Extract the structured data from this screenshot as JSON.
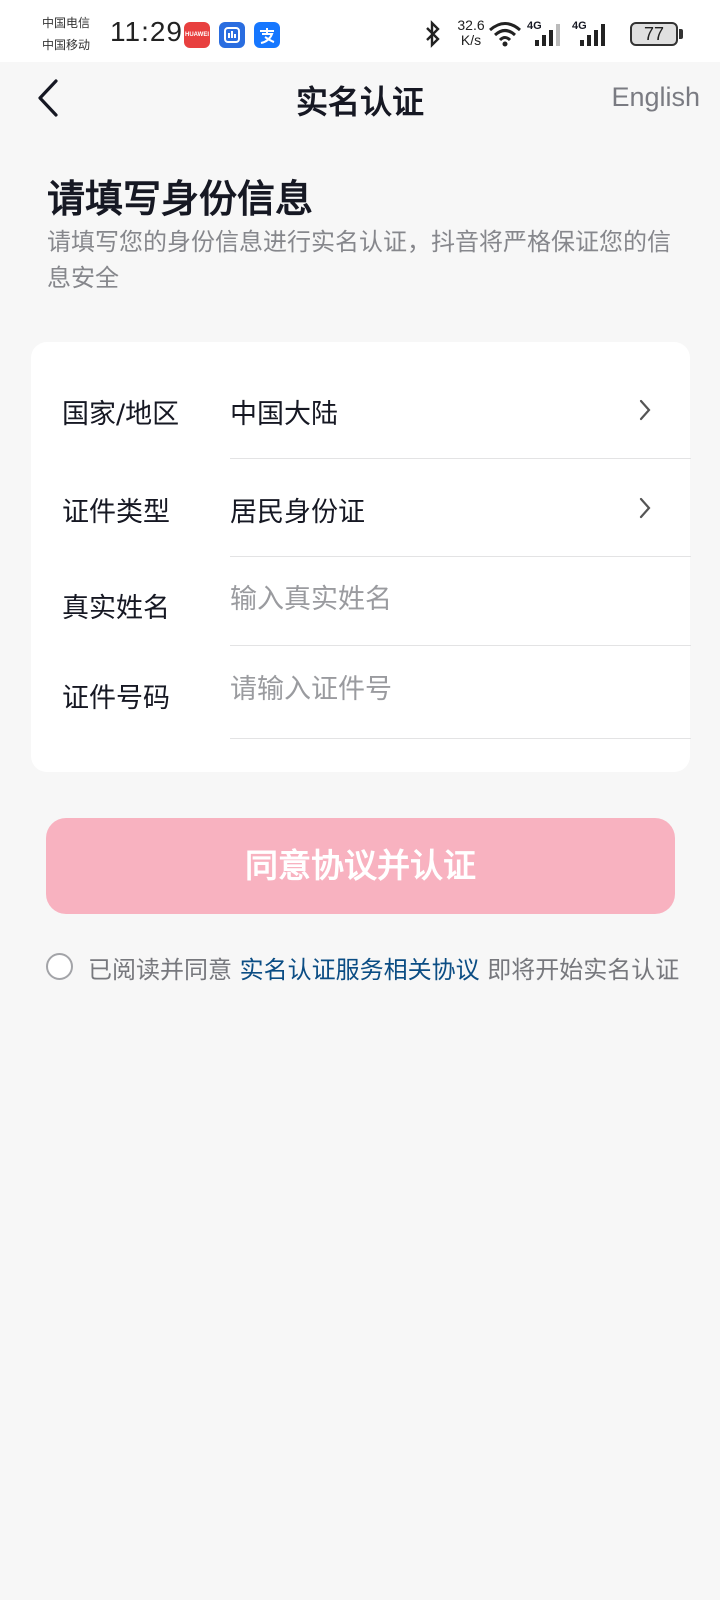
{
  "status_bar": {
    "carrier1": "中国电信",
    "carrier2": "中国移动",
    "time": "11:29",
    "app_icons": [
      "huawei-appgallery-icon",
      "huawei-sticker-icon",
      "alipay-icon"
    ],
    "huawei_label": "HUAWEI",
    "network_speed_value": "32.6",
    "network_speed_unit": "K/s",
    "signal1_label": "4G",
    "signal2_label": "4G",
    "battery": "77"
  },
  "nav": {
    "title": "实名认证",
    "language_link": "English"
  },
  "header": {
    "title": "请填写身份信息",
    "subtitle": "请填写您的身份信息进行实名认证，抖音将严格保证您的信息安全"
  },
  "form": {
    "rows": [
      {
        "label": "国家/地区",
        "value": "中国大陆",
        "type": "select"
      },
      {
        "label": "证件类型",
        "value": "居民身份证",
        "type": "select"
      },
      {
        "label": "真实姓名",
        "placeholder": "输入真实姓名",
        "value": "",
        "type": "input"
      },
      {
        "label": "证件号码",
        "placeholder": "请输入证件号",
        "value": "",
        "type": "input"
      }
    ]
  },
  "submit": {
    "label": "同意协议并认证",
    "color": "#f8b2c0"
  },
  "agreement": {
    "checked": false,
    "prefix": "已阅读并同意 ",
    "link": "实名认证服务相关协议",
    "suffix": " 即将开始实名认证",
    "link_color": "#0b4d84"
  }
}
